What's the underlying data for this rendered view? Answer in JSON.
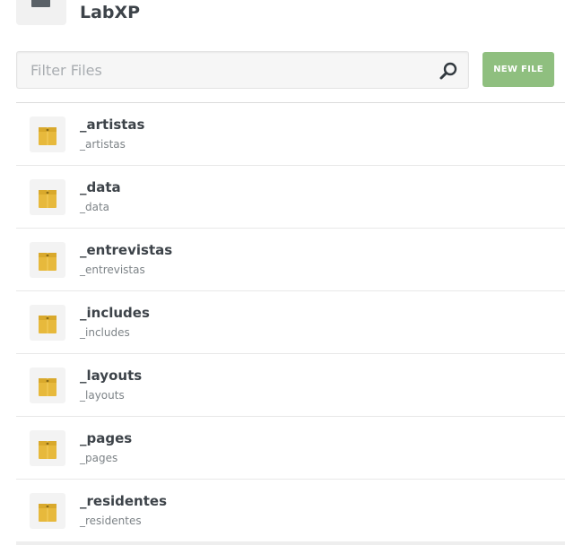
{
  "site": {
    "title": "LabXP"
  },
  "filter": {
    "placeholder": "Filter Files",
    "value": ""
  },
  "toolbar": {
    "new_file_label": "NEW FILE"
  },
  "files": [
    {
      "name": "_artistas",
      "path": "_artistas",
      "icon": "folder-icon"
    },
    {
      "name": "_data",
      "path": "_data",
      "icon": "folder-icon"
    },
    {
      "name": "_entrevistas",
      "path": "_entrevistas",
      "icon": "folder-icon"
    },
    {
      "name": "_includes",
      "path": "_includes",
      "icon": "folder-icon"
    },
    {
      "name": "_layouts",
      "path": "_layouts",
      "icon": "folder-icon"
    },
    {
      "name": "_pages",
      "path": "_pages",
      "icon": "folder-icon"
    },
    {
      "name": "_residentes",
      "path": "_residentes",
      "icon": "folder-icon"
    }
  ],
  "colors": {
    "accent_button": "#8fbf7f",
    "folder": "#e7b93c",
    "text_dark": "#3d4349"
  }
}
